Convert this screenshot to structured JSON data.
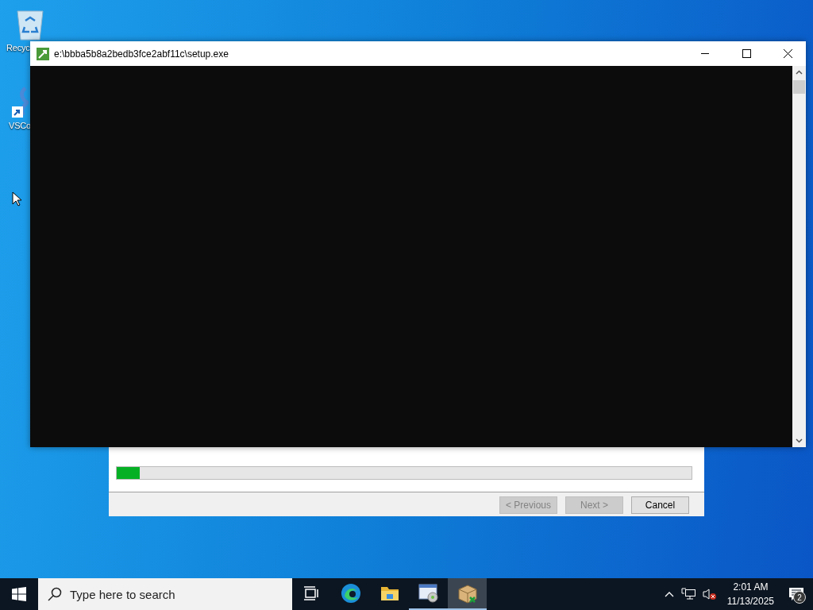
{
  "desktop_icons": [
    {
      "kind": "recycle-bin",
      "label": "Recyc"
    },
    {
      "kind": "shortcut",
      "label": "VSCo"
    }
  ],
  "console_window": {
    "title": "e:\\bbba5b8a2bedb3fce2abf11c\\setup.exe"
  },
  "installer": {
    "progress": {
      "level": 0.04
    },
    "buttons": [
      {
        "label": "< Previous",
        "disabled": true
      },
      {
        "label": "Next >",
        "disabled": true
      },
      {
        "label": "Cancel",
        "disabled": false
      }
    ]
  },
  "taskbar": {
    "search": {
      "placeholder": "Type here to search"
    },
    "apps": [
      {
        "kind": "task-view",
        "running": false,
        "selected": false
      },
      {
        "kind": "browser",
        "running": false,
        "selected": false
      },
      {
        "kind": "folder",
        "running": false,
        "selected": false
      },
      {
        "kind": "window-app",
        "running": true,
        "selected": false
      },
      {
        "kind": "package",
        "running": true,
        "selected": true
      }
    ],
    "clock": {
      "time": "2:01 AM",
      "date": "11/13/2025"
    },
    "notifications": {
      "count": "2"
    }
  }
}
